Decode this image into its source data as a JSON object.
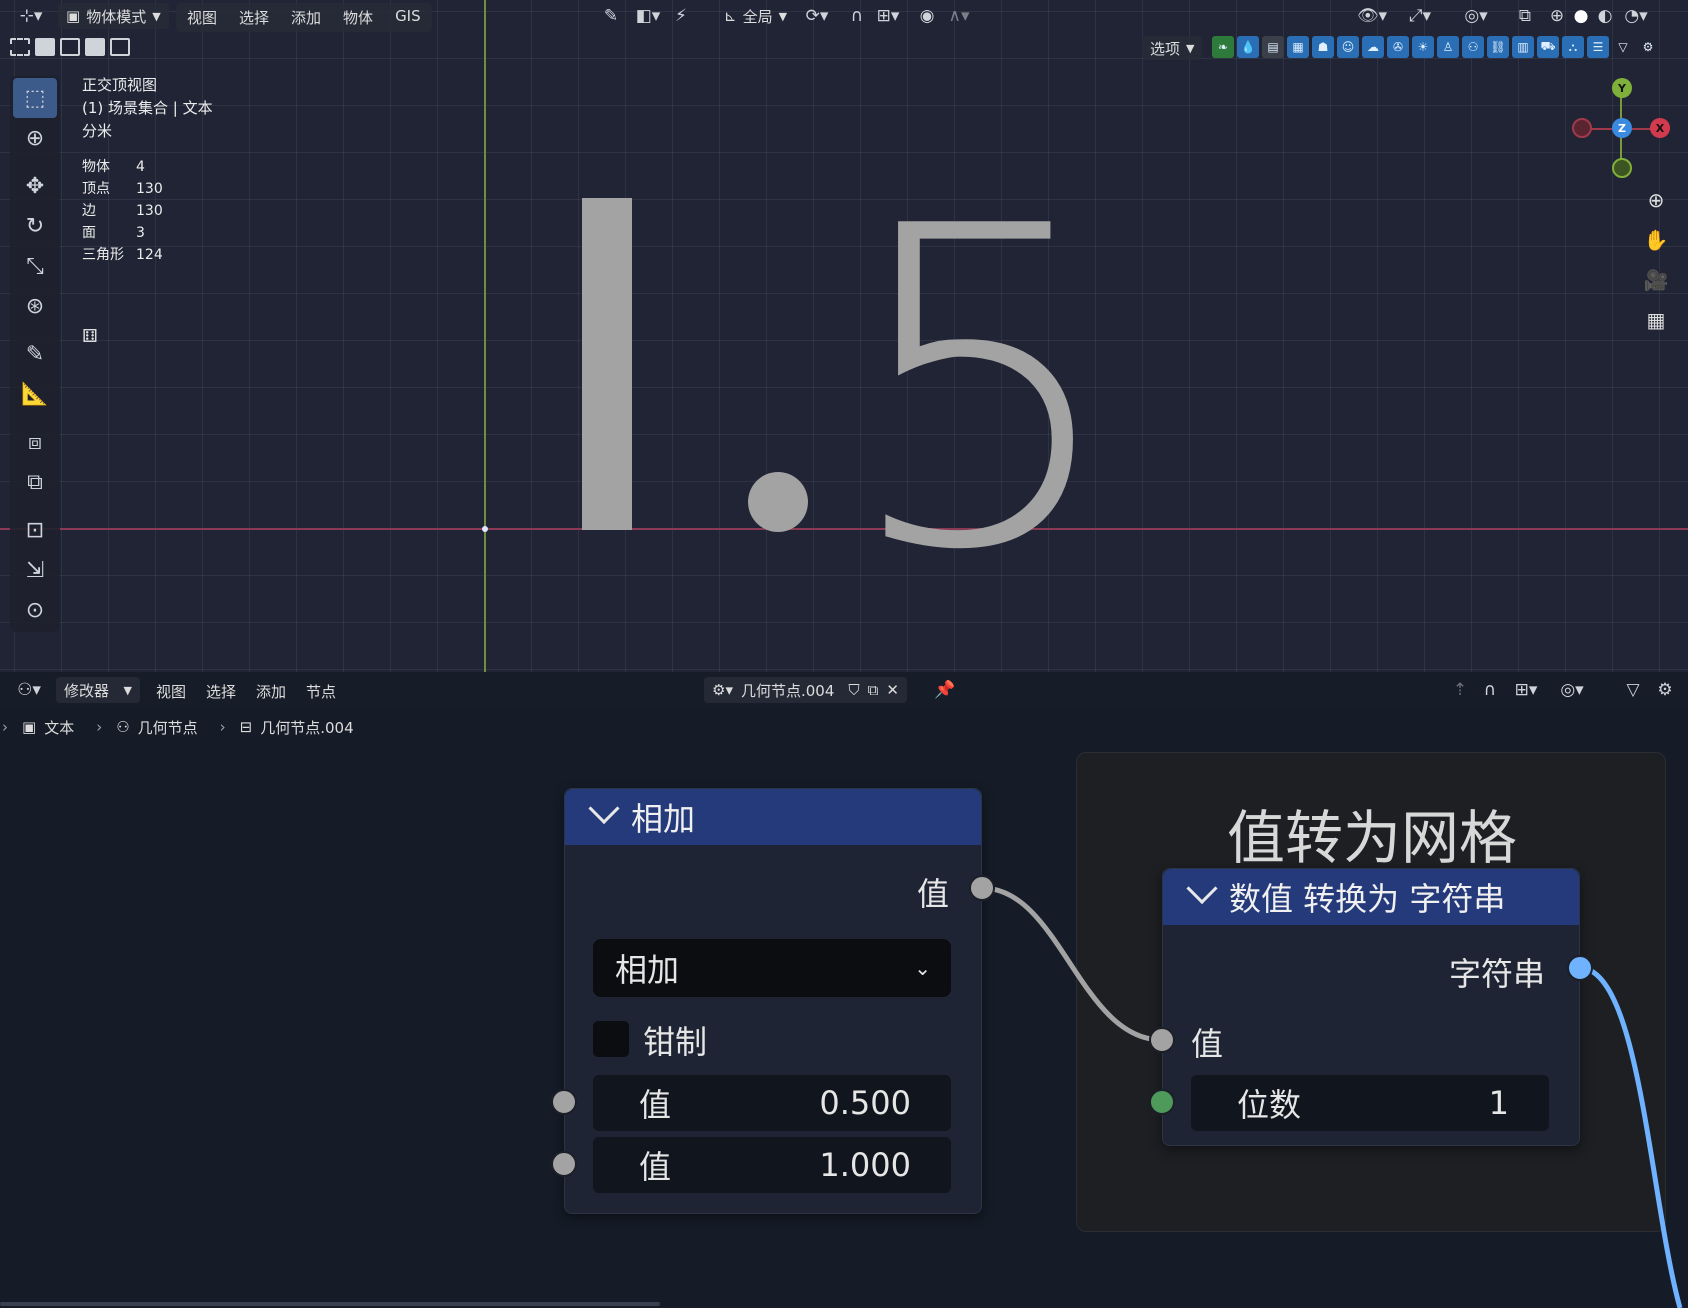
{
  "viewport": {
    "header": {
      "mode_label": "物体模式",
      "menus": [
        "视图",
        "选择",
        "添加",
        "物体",
        "GIS"
      ],
      "transform_orientation": "全局",
      "options_label": "选项"
    },
    "overlay": {
      "view_name": "正交顶视图",
      "collection": "(1) 场景集合 | 文本",
      "unit": "分米"
    },
    "stats": [
      {
        "label": "物体",
        "value": "4"
      },
      {
        "label": "顶点",
        "value": "130"
      },
      {
        "label": "边",
        "value": "130"
      },
      {
        "label": "面",
        "value": "3"
      },
      {
        "label": "三角形",
        "value": "124"
      }
    ],
    "text_object_display": "1.5",
    "gizmo": {
      "x": "X",
      "y": "Y",
      "z": "Z"
    }
  },
  "node_editor": {
    "header": {
      "editor_type_label": "修改器",
      "menus": [
        "视图",
        "选择",
        "添加",
        "节点"
      ],
      "node_tree_name": "几何节点.004"
    },
    "breadcrumb": [
      "文本",
      "几何节点",
      "几何节点.004"
    ],
    "frame_label": "值转为网格",
    "add_node": {
      "title": "相加",
      "output_label": "值",
      "operation": "相加",
      "clamp_label": "钳制",
      "inputs": [
        {
          "label": "值",
          "value": "0.500"
        },
        {
          "label": "值",
          "value": "1.000"
        }
      ]
    },
    "to_string_node": {
      "title": "数值 转换为 字符串",
      "output_label": "字符串",
      "input_value_label": "值",
      "decimals_label": "位数",
      "decimals_value": "1"
    }
  },
  "colors": {
    "node_header": "#243a7a",
    "socket_float": "#a3a3a3",
    "socket_string": "#6fb2ff",
    "socket_int": "#4e9a5a",
    "axis_x": "#8a3a55",
    "axis_y": "#6f8f3b"
  }
}
